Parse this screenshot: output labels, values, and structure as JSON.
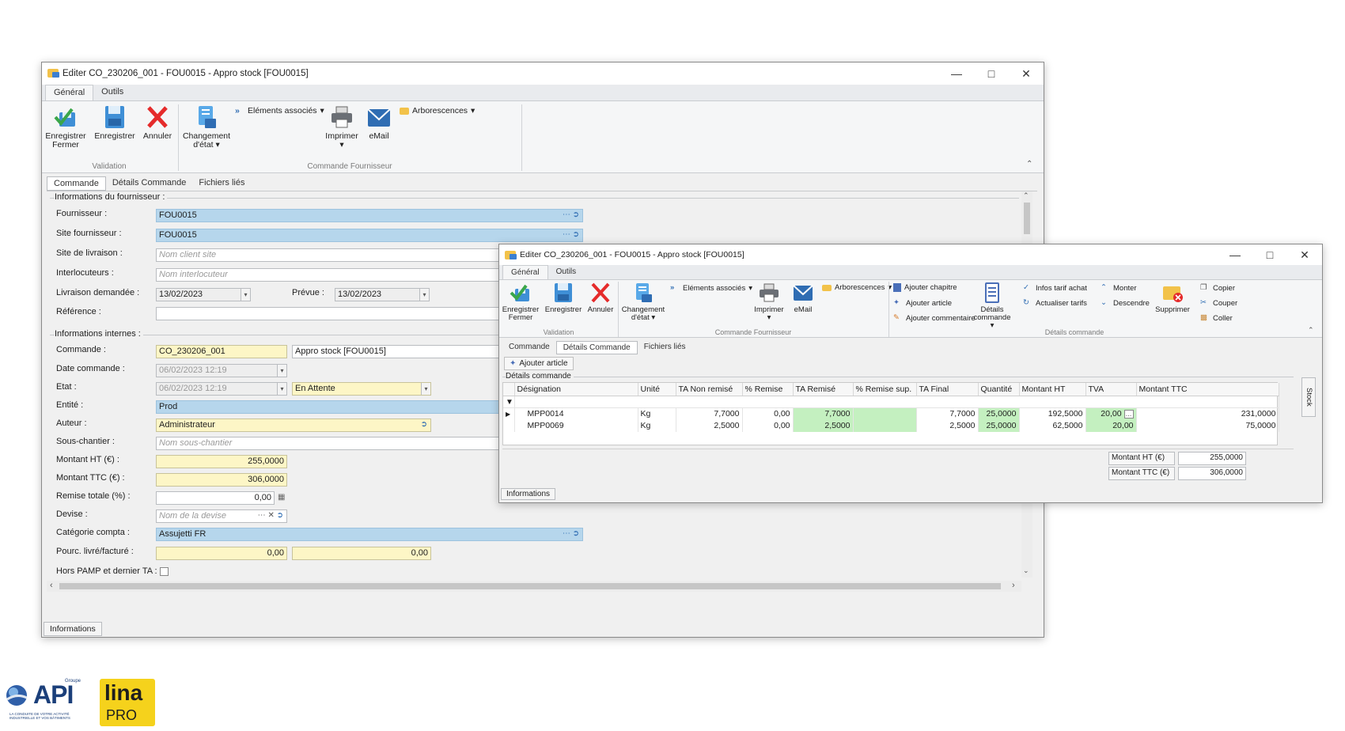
{
  "win1": {
    "title": "Editer CO_230206_001 - FOU0015 - Appro stock [FOU0015]",
    "ribbon_tabs": [
      "Général",
      "Outils"
    ],
    "buttons": {
      "save_close_1": "Enregistrer",
      "save_close_2": "Fermer",
      "save": "Enregistrer",
      "cancel": "Annuler",
      "state_1": "Changement",
      "state_2": "d'état",
      "assoc": "Eléments associés",
      "print": "Imprimer",
      "email": "eMail",
      "tree": "Arborescences"
    },
    "groups": {
      "validation": "Validation",
      "commande": "Commande Fournisseur"
    },
    "sub_tabs": [
      "Commande",
      "Détails Commande",
      "Fichiers liés"
    ],
    "supplier_group": "Informations du fournisseur :",
    "internal_group": "Informations internes :",
    "labels": {
      "fournisseur": "Fournisseur :",
      "site_fournisseur": "Site fournisseur :",
      "site_livraison": "Site de livraison :",
      "interlocuteurs": "Interlocuteurs :",
      "livraison": "Livraison demandée :",
      "prevue": "Prévue :",
      "reference": "Référence :",
      "commande": "Commande :",
      "date_commande": "Date commande :",
      "etat": "Etat :",
      "entite": "Entité :",
      "auteur": "Auteur :",
      "sous_chantier": "Sous-chantier :",
      "montant_ht": "Montant HT (€) :",
      "montant_ttc": "Montant TTC (€) :",
      "remise": "Remise totale (%) :",
      "devise": "Devise :",
      "categorie": "Catégorie compta :",
      "pourc": "Pourc. livré/facturé :",
      "hors_pamp": "Hors PAMP et dernier TA :"
    },
    "values": {
      "fournisseur": "FOU0015",
      "site_fournisseur": "FOU0015",
      "site_livraison_ph": "Nom client site",
      "interlocuteur_ph": "Nom interlocuteur",
      "livraison": "13/02/2023",
      "prevue": "13/02/2023",
      "commande": "CO_230206_001",
      "commande_lib": "Appro stock [FOU0015]",
      "date_commande": "06/02/2023 12:19",
      "etat_date": "06/02/2023 12:19",
      "etat": "En Attente",
      "entite": "Prod",
      "auteur": "Administrateur",
      "sous_chantier_ph": "Nom sous-chantier",
      "montant_ht": "255,0000",
      "montant_ttc": "306,0000",
      "remise": "0,00",
      "devise_ph": "Nom de la devise",
      "categorie": "Assujetti FR",
      "pourc_livre": "0,00",
      "pourc_facture": "0,00"
    },
    "info_tab": "Informations"
  },
  "win2": {
    "title": "Editer CO_230206_001 - FOU0015 - Appro stock [FOU0015]",
    "ribbon_tabs": [
      "Général",
      "Outils"
    ],
    "buttons": {
      "save_close_1": "Enregistrer",
      "save_close_2": "Fermer",
      "save": "Enregistrer",
      "cancel": "Annuler",
      "state_1": "Changement",
      "state_2": "d'état",
      "assoc": "Eléments associés",
      "print": "Imprimer",
      "email": "eMail",
      "tree": "Arborescences",
      "add_chapter": "Ajouter chapitre",
      "add_article": "Ajouter article",
      "add_comment": "Ajouter commentaire",
      "details_1": "Détails",
      "details_2": "commande",
      "info_tarif": "Infos tarif achat",
      "refresh_tarif": "Actualiser tarifs",
      "up": "Monter",
      "down": "Descendre",
      "delete": "Supprimer",
      "copy": "Copier",
      "cut": "Couper",
      "paste": "Coller"
    },
    "groups": {
      "validation": "Validation",
      "commande": "Commande Fournisseur",
      "details": "Détails commande"
    },
    "sub_tabs": [
      "Commande",
      "Détails Commande",
      "Fichiers liés"
    ],
    "add_article_btn": "Ajouter article",
    "details_group": "Détails commande",
    "side_tab": "Stock",
    "columns": [
      "Désignation",
      "Unité",
      "TA Non remisé",
      "% Remise",
      "TA Remisé",
      "% Remise sup.",
      "TA Final",
      "Quantité",
      "Montant HT",
      "TVA",
      "Montant TTC"
    ],
    "rows": [
      {
        "designation": "MPP0014",
        "unite": "Kg",
        "ta_non_remise": "7,7000",
        "remise": "0,00",
        "ta_remise": "7,7000",
        "remise_sup": "",
        "ta_final": "7,7000",
        "quantite": "25,0000",
        "montant_ht": "192,5000",
        "tva": "20,00",
        "montant_ttc": "231,0000"
      },
      {
        "designation": "MPP0069",
        "unite": "Kg",
        "ta_non_remise": "2,5000",
        "remise": "0,00",
        "ta_remise": "2,5000",
        "remise_sup": "",
        "ta_final": "2,5000",
        "quantite": "25,0000",
        "montant_ht": "62,5000",
        "tva": "20,00",
        "montant_ttc": "75,0000"
      }
    ],
    "totals": {
      "ht_label": "Montant HT (€)",
      "ht_value": "255,0000",
      "ttc_label": "Montant TTC (€)",
      "ttc_value": "306,0000"
    },
    "info_tab": "Informations"
  },
  "logo": {
    "groupe": "Groupe",
    "api": "API",
    "tagline": "LA CONDUITE DE VOTRE ACTIVITÉ INDUSTRIELLE ET VOS BÂTIMENTS",
    "lina": "lina",
    "pro": "PRO"
  },
  "colors": {
    "field_blue": "#b6d6ec",
    "field_yellow": "#fdf6c6",
    "grid_green": "#c4f0c0",
    "accent_blue": "#2f6db3"
  }
}
